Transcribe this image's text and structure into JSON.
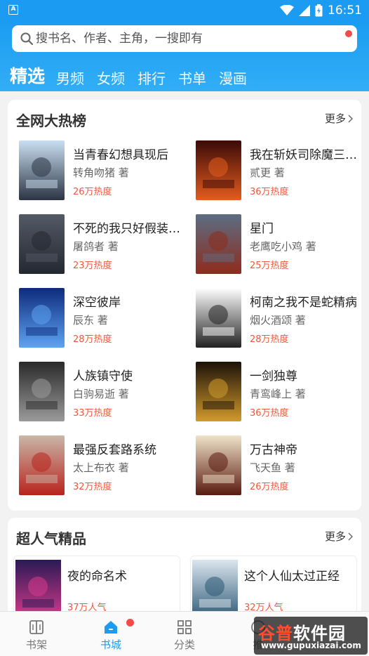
{
  "status_bar": {
    "time": "16:51",
    "notification_icon": "A"
  },
  "search": {
    "placeholder": "搜书名、作者、主角，一搜即有"
  },
  "tabs": [
    {
      "label": "精选",
      "active": true
    },
    {
      "label": "男频"
    },
    {
      "label": "女频"
    },
    {
      "label": "排行"
    },
    {
      "label": "书单"
    },
    {
      "label": "漫画"
    }
  ],
  "hot_list": {
    "title": "全网大热榜",
    "more": "更多",
    "books": [
      {
        "title": "当青春幻想具现后",
        "author": "转角吻猪 著",
        "heat": "26万热度",
        "cover_colors": [
          "#c9dff1",
          "#2c3444"
        ]
      },
      {
        "title": "我在斩妖司除魔三十年",
        "author": "贰更 著",
        "heat": "36万热度",
        "cover_colors": [
          "#3b0a08",
          "#e45c1e"
        ]
      },
      {
        "title": "不死的我只好假装无敌",
        "author": "屠鸽者 著",
        "heat": "23万热度",
        "cover_colors": [
          "#545a66",
          "#232831"
        ]
      },
      {
        "title": "星门",
        "author": "老鹰吃小鸡 著",
        "heat": "25万热度",
        "cover_colors": [
          "#5b6e84",
          "#8e2b1c"
        ]
      },
      {
        "title": "深空彼岸",
        "author": "辰东 著",
        "heat": "28万热度",
        "cover_colors": [
          "#0e2b7d",
          "#5ea3f2"
        ]
      },
      {
        "title": "柯南之我不是蛇精病",
        "author": "烟火酒颂 著",
        "heat": "28万热度",
        "cover_colors": [
          "#ffffff",
          "#222222"
        ]
      },
      {
        "title": "人族镇守使",
        "author": "白驹易逝 著",
        "heat": "33万热度",
        "cover_colors": [
          "#2a2a2a",
          "#9a9a9a"
        ]
      },
      {
        "title": "一剑独尊",
        "author": "青鸾峰上 著",
        "heat": "36万热度",
        "cover_colors": [
          "#1c1209",
          "#d29a2c"
        ]
      },
      {
        "title": "最强反套路系统",
        "author": "太上布衣 著",
        "heat": "32万热度",
        "cover_colors": [
          "#c9b6a8",
          "#b8241d"
        ]
      },
      {
        "title": "万古神帝",
        "author": "飞天鱼 著",
        "heat": "26万热度",
        "cover_colors": [
          "#efe3c9",
          "#5a1a10"
        ]
      }
    ]
  },
  "popular": {
    "title": "超人气精品",
    "more": "更多",
    "books": [
      {
        "title": "夜的命名术",
        "heat": "37万人气",
        "cover_colors": [
          "#2a1a55",
          "#d93a8c"
        ]
      },
      {
        "title": "这个人仙太过正经",
        "heat": "32万人气",
        "cover_colors": [
          "#dbe6ee",
          "#2c5874"
        ]
      }
    ]
  },
  "bottom_nav": [
    {
      "label": "书架",
      "icon": "bookshelf-icon"
    },
    {
      "label": "书城",
      "icon": "bookstore-home-icon",
      "active": true,
      "badge": true
    },
    {
      "label": "分类",
      "icon": "category-grid-icon"
    },
    {
      "label": "推",
      "icon": "recommend-icon"
    }
  ],
  "watermark": {
    "logo_a": "谷普",
    "logo_b": "软件园",
    "url": "www.gupuxiazai.com"
  },
  "colors": {
    "primary": "#1b9cf2",
    "heat": "#f0583a",
    "badge": "#f24b4b"
  }
}
